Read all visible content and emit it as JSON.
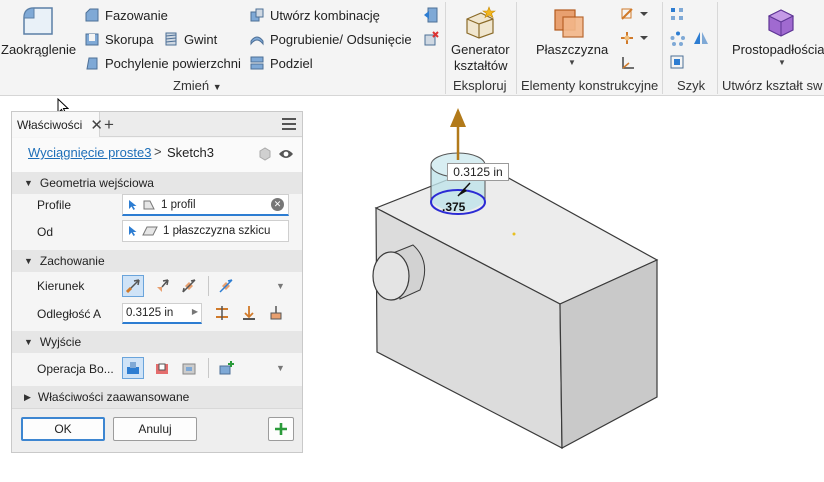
{
  "ribbon": {
    "modify": {
      "fillet": "Zaokrąglenie",
      "chamfer": "Fazowanie",
      "shell": "Skorupa",
      "thread": "Gwint",
      "draft": "Pochylenie powierzchni",
      "combine": "Utwórz kombinację",
      "thicken": "Pogrubienie/ Odsunięcie",
      "split": "Podziel",
      "group_label": "Zmień"
    },
    "explore": {
      "generator_line1": "Generator",
      "generator_line2": "kształtów",
      "group_label": "Eksploruj"
    },
    "work_features": {
      "plane": "Płaszczyzna",
      "group_label": "Elementy konstrukcyjne"
    },
    "pattern": {
      "group_label": "Szyk"
    },
    "create_freeform": {
      "box": "Prostopadłościan",
      "group_label": "Utwórz kształt sw"
    }
  },
  "panel": {
    "tab_label": "Właściwości",
    "breadcrumb_link": "Wyciągnięcie proste3",
    "breadcrumb_sep": ">",
    "breadcrumb_current": "Sketch3",
    "sections": {
      "input_geometry": "Geometria wejściowa",
      "behavior": "Zachowanie",
      "output": "Wyjście",
      "advanced": "Właściwości zaawansowane"
    },
    "profiles_label": "Profile",
    "profiles_value": "1 profil",
    "from_label": "Od",
    "from_value": "1 płaszczyzna szkicu",
    "direction_label": "Kierunek",
    "distance_label": "Odległość A",
    "distance_value": "0.3125 in",
    "boolean_label": "Operacja Bo...",
    "ok_label": "OK",
    "cancel_label": "Anuluj"
  },
  "viewport": {
    "dimension_value": "0.3125 in",
    "dimension_small": ".375"
  },
  "colors": {
    "accent": "#2d7dd2",
    "arrow": "#b27a1a",
    "profile_fill": "#bfe3ea",
    "profile_edge": "#2b2bd4"
  }
}
